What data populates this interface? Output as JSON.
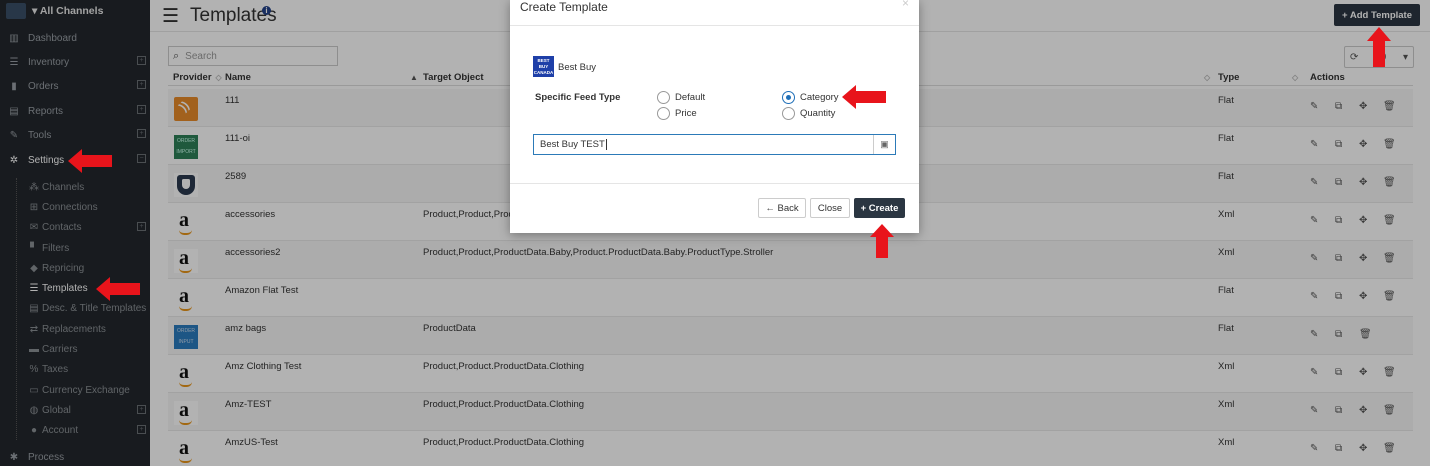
{
  "sidebar": {
    "channel_selector": "All Channels",
    "items": [
      {
        "label": "Dashboard",
        "icon": "bar-chart-icon"
      },
      {
        "label": "Inventory",
        "icon": "list-icon"
      },
      {
        "label": "Orders",
        "icon": "signal-icon"
      },
      {
        "label": "Reports",
        "icon": "document-icon"
      },
      {
        "label": "Tools",
        "icon": "wrench-icon"
      },
      {
        "label": "Settings",
        "icon": "gear-icon"
      }
    ],
    "settings_sub": [
      {
        "label": "Channels",
        "icon": "sitemap-icon"
      },
      {
        "label": "Connections",
        "icon": "plug-icon"
      },
      {
        "label": "Contacts",
        "icon": "envelope-icon"
      },
      {
        "label": "Filters",
        "icon": "file-icon"
      },
      {
        "label": "Repricing",
        "icon": "tag-icon"
      },
      {
        "label": "Templates",
        "icon": "list-icon"
      },
      {
        "label": "Desc. & Title Templates",
        "icon": "table-icon"
      },
      {
        "label": "Replacements",
        "icon": "exchange-icon"
      },
      {
        "label": "Carriers",
        "icon": "truck-icon"
      },
      {
        "label": "Taxes",
        "icon": "percent-icon"
      },
      {
        "label": "Currency Exchange",
        "icon": "money-icon"
      },
      {
        "label": "Global",
        "icon": "globe-icon"
      },
      {
        "label": "Account",
        "icon": "user-icon"
      }
    ],
    "process_label": "Process"
  },
  "header": {
    "title": "Templates",
    "add_button": "+ Add Template"
  },
  "search": {
    "placeholder": "Search"
  },
  "paging": {
    "value": "10"
  },
  "table": {
    "columns": [
      "Provider",
      "Name",
      "Target Object",
      "Type",
      "Actions"
    ],
    "rows": [
      {
        "provider": "rss-icon",
        "name": "111",
        "target": "",
        "type": "Flat"
      },
      {
        "provider": "order-import-icon",
        "name": "111-oi",
        "target": "",
        "type": "Flat"
      },
      {
        "provider": "shield-icon",
        "name": "2589",
        "target": "",
        "type": "Flat"
      },
      {
        "provider": "amazon-icon",
        "name": "accessories",
        "target": "Product,Product,Prod",
        "type": "Xml"
      },
      {
        "provider": "amazon-icon",
        "name": "accessories2",
        "target": "Product,Product,ProductData.Baby,Product.ProductData.Baby.ProductType.Stroller",
        "type": "Xml"
      },
      {
        "provider": "amazon-icon",
        "name": "Amazon Flat Test",
        "target": "",
        "type": "Flat"
      },
      {
        "provider": "order-input-icon",
        "name": "amz bags",
        "target": "ProductData",
        "type": "Flat"
      },
      {
        "provider": "amazon-icon",
        "name": "Amz Clothing Test",
        "target": "Product,Product.ProductData.Clothing",
        "type": "Xml"
      },
      {
        "provider": "amazon-icon",
        "name": "Amz-TEST",
        "target": "Product,Product.ProductData.Clothing",
        "type": "Xml"
      },
      {
        "provider": "amazon-icon",
        "name": "AmzUS-Test",
        "target": "Product,Product.ProductData.Clothing",
        "type": "Xml"
      }
    ]
  },
  "modal": {
    "title": "Create Template",
    "close_symbol": "×",
    "channel_name": "Best Buy",
    "logo_text": "BEST BUY CANADA",
    "feed_type_label": "Specific Feed Type",
    "options": [
      "Default",
      "Category",
      "Price",
      "Quantity"
    ],
    "selected_option": "Category",
    "name_value": "Best Buy TEST",
    "back_button": "← Back",
    "close_button": "Close",
    "create_button": "+ Create"
  },
  "colors": {
    "sidebar_bg": "#23282d",
    "accent_dark": "#2b3642",
    "radio_selected": "#1f6fb8",
    "annotation_arrow": "#e8141b"
  }
}
